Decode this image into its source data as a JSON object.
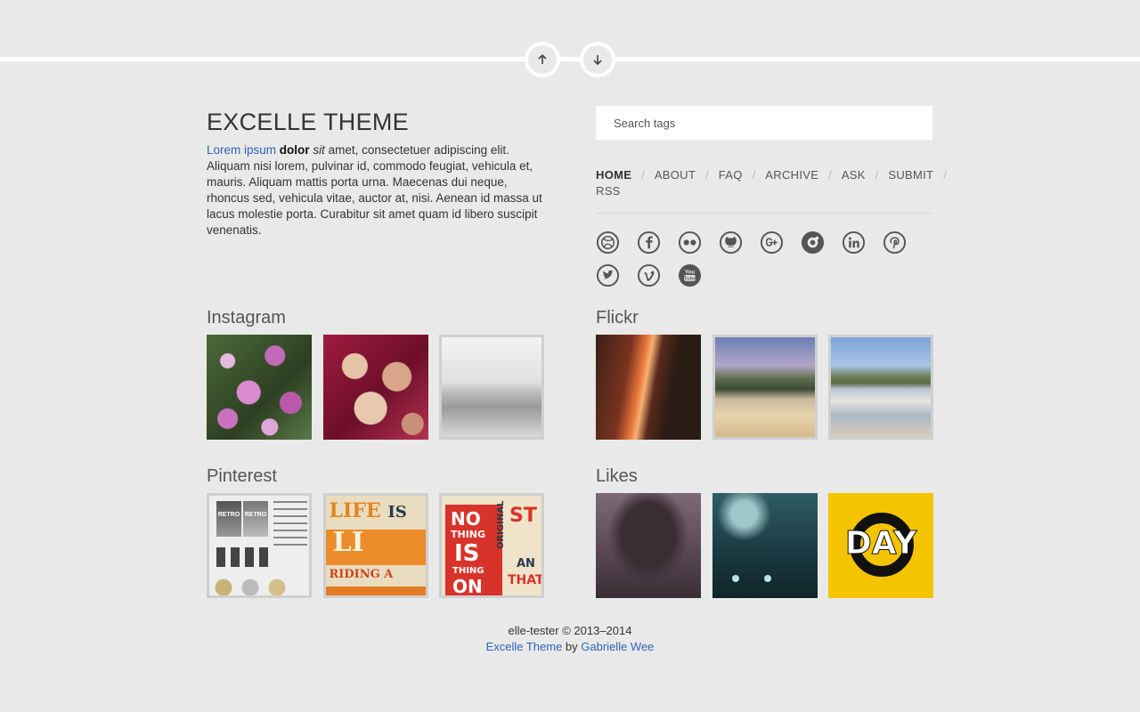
{
  "nav": {
    "up_icon": "arrow-up-icon",
    "down_icon": "arrow-down-icon"
  },
  "blog": {
    "title": "EXCELLE THEME",
    "desc_link": "Lorem ipsum",
    "desc_bold": "dolor",
    "desc_italic": "sit",
    "desc_rest": " amet, consectetuer adipiscing elit. Aliquam nisi lorem, pulvinar id, commodo feugiat, vehicula et, mauris. Aliquam mattis porta urna. Maecenas dui neque, rhoncus sed, vehicula vitae, auctor at, nisi. Aenean id massa ut lacus molestie porta. Curabitur sit amet quam id libero suscipit venenatis."
  },
  "search": {
    "placeholder": "Search tags"
  },
  "menu": {
    "home": "HOME",
    "about": "ABOUT",
    "faq": "FAQ",
    "archive": "ARCHIVE",
    "ask": "ASK",
    "submit": "SUBMIT",
    "rss": "RSS",
    "separator": "/"
  },
  "social": [
    "dribbble-icon",
    "facebook-icon",
    "flickr-icon",
    "github-icon",
    "google-plus-icon",
    "lastfm-icon",
    "linkedin-icon",
    "pinterest-icon",
    "twitter-icon",
    "vimeo-icon",
    "youtube-icon"
  ],
  "sections": {
    "instagram": {
      "title": "Instagram"
    },
    "flickr": {
      "title": "Flickr"
    },
    "pinterest": {
      "title": "Pinterest",
      "thumb1": {
        "badge1": "RETRO",
        "badge2": "RETRO"
      },
      "thumb2": {
        "line1": "LIFE",
        "line2": "IS",
        "line3": "LI",
        "line4": "RIDING A"
      },
      "thumb3": {
        "w1": "NO",
        "w2": "THING",
        "w3": "IS",
        "w4": "THING",
        "w5": "ON",
        "w6": "ORIGINAL",
        "w7": "ST",
        "w8": "AN",
        "w9": "THAT"
      }
    },
    "likes": {
      "title": "Likes",
      "day_text": "DAY"
    }
  },
  "footer": {
    "line1": "elle-tester © 2013–2014",
    "theme_link": "Excelle Theme",
    "by": " by ",
    "author_link": "Gabrielle Wee"
  },
  "colors": {
    "background": "#e9e9e9",
    "link": "#2e63b8",
    "accent_yellow": "#f5c400"
  }
}
